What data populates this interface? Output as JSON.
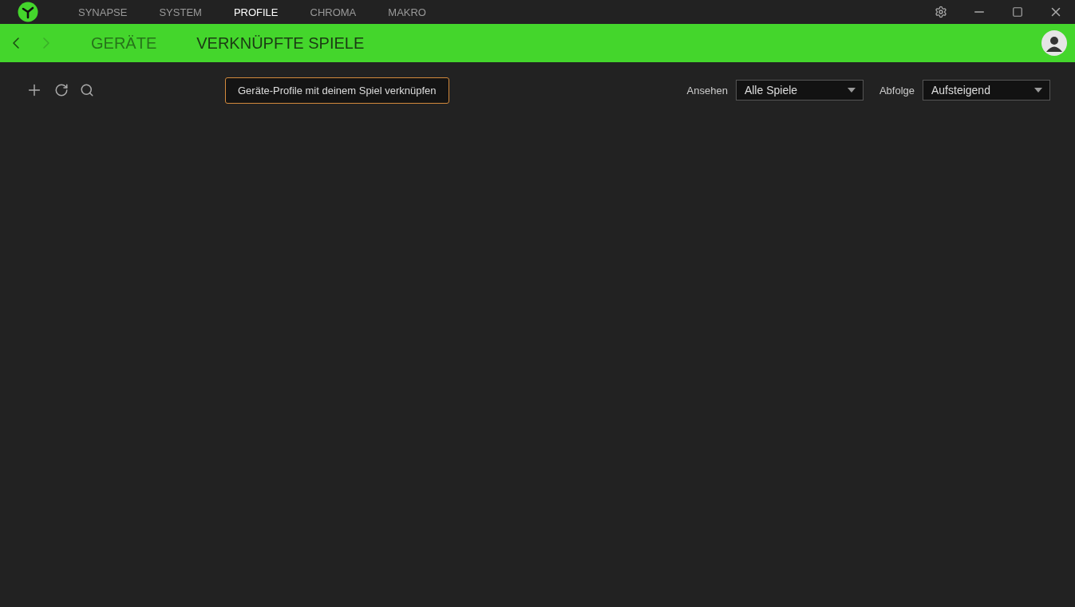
{
  "top_tabs": [
    {
      "label": "SYNAPSE",
      "selected": false
    },
    {
      "label": "SYSTEM",
      "selected": false
    },
    {
      "label": "PROFILE",
      "selected": true
    },
    {
      "label": "CHROMA",
      "selected": false
    },
    {
      "label": "MAKRO",
      "selected": false
    }
  ],
  "sub_tabs": [
    {
      "label": "GERÄTE",
      "selected": false
    },
    {
      "label": "VERKNÜPFTE SPIELE",
      "selected": true
    }
  ],
  "tooltip": "Geräte-Profile mit deinem Spiel verknüpfen",
  "filters": [
    {
      "label": "Ansehen",
      "value": "Alle Spiele"
    },
    {
      "label": "Abfolge",
      "value": "Aufsteigend"
    }
  ]
}
